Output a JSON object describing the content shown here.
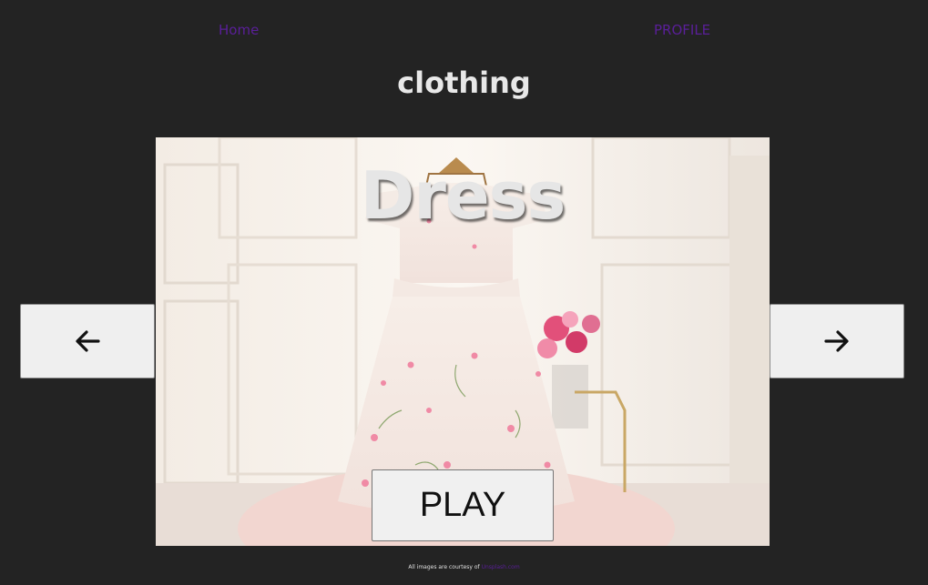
{
  "nav": {
    "home_label": "Home",
    "profile_label": "PROFILE",
    "link_color": "#5a1f99"
  },
  "page": {
    "title": "clothing"
  },
  "carousel": {
    "item_title": "Dress",
    "play_label": "PLAY",
    "prev_icon": "arrow-left-icon",
    "next_icon": "arrow-right-icon"
  },
  "footer": {
    "credit_text": "All images are courtesy of",
    "credit_link": "Unsplash.com",
    "link_color": "#5a1f99"
  }
}
